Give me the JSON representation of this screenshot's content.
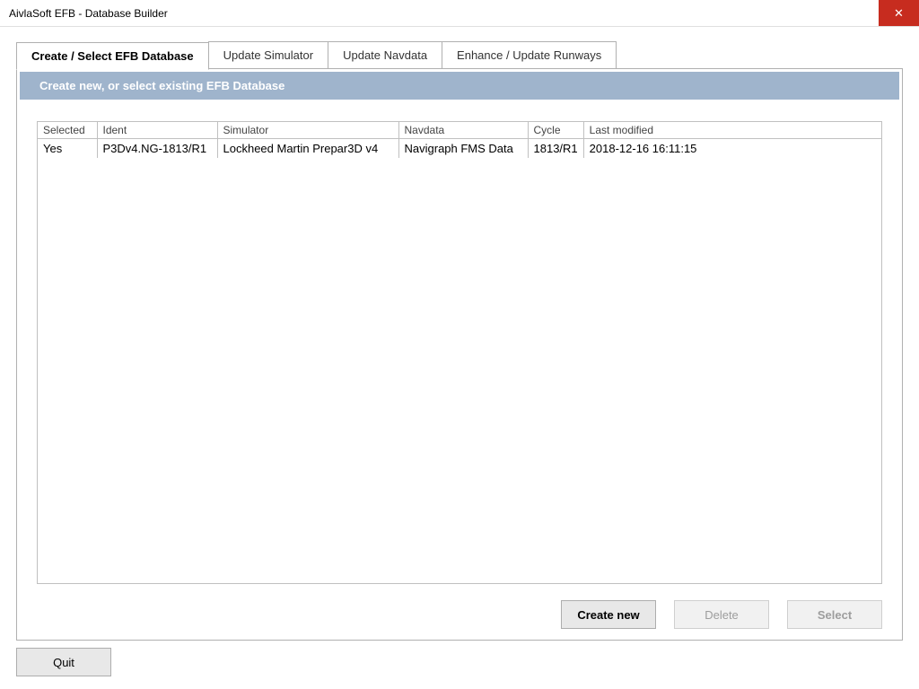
{
  "window": {
    "title": "AivlaSoft EFB - Database Builder",
    "close_glyph": "✕"
  },
  "tabs": [
    {
      "label": "Create / Select EFB Database",
      "active": true
    },
    {
      "label": "Update Simulator",
      "active": false
    },
    {
      "label": "Update Navdata",
      "active": false
    },
    {
      "label": "Enhance / Update Runways",
      "active": false
    }
  ],
  "panel": {
    "header": "Create new, or select existing EFB Database"
  },
  "table": {
    "columns": [
      "Selected",
      "Ident",
      "Simulator",
      "Navdata",
      "Cycle",
      "Last modified"
    ],
    "rows": [
      {
        "selected": "Yes",
        "ident": "P3Dv4.NG-1813/R1",
        "simulator": "Lockheed Martin Prepar3D v4",
        "navdata": "Navigraph FMS Data",
        "cycle": "1813/R1",
        "last_modified": "2018-12-16 16:11:15"
      }
    ]
  },
  "buttons": {
    "create_new": "Create new",
    "delete": "Delete",
    "select": "Select",
    "quit": "Quit"
  }
}
